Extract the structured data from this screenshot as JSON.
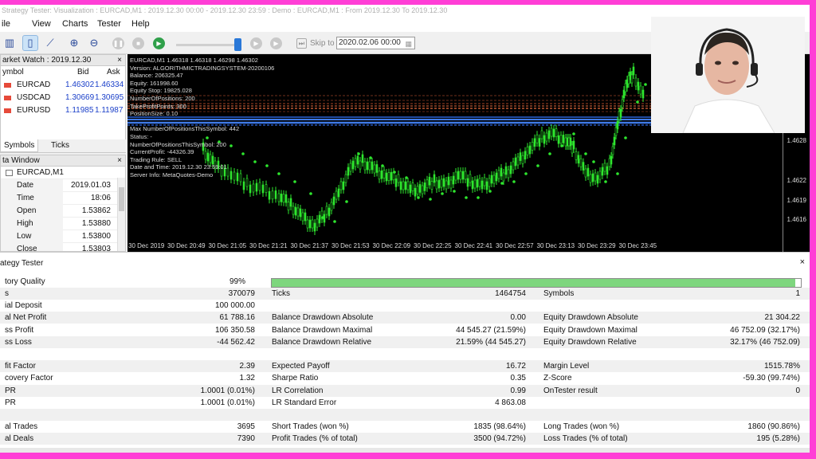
{
  "window": {
    "title": "Strategy Tester: Visualization : EURCAD,M1 : 2019.12.30 00:00 - 2019.12.30 23:59 : Demo : EURCAD,M1 : From 2019.12.30 To 2019.12.30"
  },
  "menu": [
    "ile",
    "View",
    "Charts",
    "Tester",
    "Help"
  ],
  "toolbar": {
    "skip_label": "Skip to",
    "skip_date": "2020.02.06 00:00"
  },
  "market_watch": {
    "title": "arket Watch : 2019.12.30",
    "columns": [
      "ymbol",
      "Bid",
      "Ask"
    ],
    "rows": [
      {
        "symbol": "EURCAD",
        "bid": "1.46302",
        "ask": "1.46334"
      },
      {
        "symbol": "USDCAD",
        "bid": "1.30669",
        "ask": "1.30695"
      },
      {
        "symbol": "EURUSD",
        "bid": "1.11985",
        "ask": "1.11987"
      }
    ],
    "tabs": [
      "Symbols",
      "Ticks"
    ]
  },
  "data_window": {
    "title": "ta Window",
    "symbol": "EURCAD,M1",
    "rows": [
      {
        "k": "Date",
        "v": "2019.01.03"
      },
      {
        "k": "Time",
        "v": "18:06"
      },
      {
        "k": "Open",
        "v": "1.53862"
      },
      {
        "k": "High",
        "v": "1.53880"
      },
      {
        "k": "Low",
        "v": "1.53800"
      },
      {
        "k": "Close",
        "v": "1.53803"
      }
    ]
  },
  "chart": {
    "header": "EURCAD,M1  1.46318 1.46318 1.46298 1.46302",
    "info_lines": [
      "Version: ALGORITHMICTRADINGSYSTEM-20200106",
      "Balance: 206325.47",
      "Equity: 161998.60",
      "Equity Stop: 19825.028",
      "NumberOfPositions: 200",
      "TakeProfitPoints: 300",
      "PositionSize: 0.10",
      "",
      "Max NumberOfPositionsThisSymbol: 442",
      "Status: -",
      "NumberOfPositionsThisSymbol: 200",
      "CurrentProfit: -44326.39",
      "Trading Rule: SELL",
      "Date and Time: 2019.12.30 23:59:01",
      "Server Info: MetaQuotes-Demo"
    ],
    "price_labels": [
      "1.4628",
      "1.4622",
      "1.4619",
      "1.4616"
    ],
    "time_labels": [
      "30 Dec 2019",
      "30 Dec 20:49",
      "30 Dec 21:05",
      "30 Dec 21:21",
      "30 Dec 21:37",
      "30 Dec 21:53",
      "30 Dec 22:09",
      "30 Dec 22:25",
      "30 Dec 22:41",
      "30 Dec 22:57",
      "30 Dec 23:13",
      "30 Dec 23:29",
      "30 Dec 23:45"
    ]
  },
  "strategy_tester": {
    "title": "ategy Tester",
    "quality_label": "tory Quality",
    "quality_value": "99%",
    "quality_fill": 0.99,
    "rows": [
      {
        "l1": "s",
        "v1": "370079",
        "l2": "Ticks",
        "v2": "1464754",
        "l3": "Symbols",
        "v3": "1"
      },
      {
        "l1": "ial Deposit",
        "v1": "100 000.00",
        "l2": "",
        "v2": "",
        "l3": "",
        "v3": ""
      },
      {
        "l1": "al Net Profit",
        "v1": "61 788.16",
        "l2": "Balance Drawdown Absolute",
        "v2": "0.00",
        "l3": "Equity Drawdown Absolute",
        "v3": "21 304.22"
      },
      {
        "l1": "ss Profit",
        "v1": "106 350.58",
        "l2": "Balance Drawdown Maximal",
        "v2": "44 545.27 (21.59%)",
        "l3": "Equity Drawdown Maximal",
        "v3": "46 752.09 (32.17%)"
      },
      {
        "l1": "ss Loss",
        "v1": "-44 562.42",
        "l2": "Balance Drawdown Relative",
        "v2": "21.59% (44 545.27)",
        "l3": "Equity Drawdown Relative",
        "v3": "32.17% (46 752.09)"
      },
      {
        "l1": "",
        "v1": "",
        "l2": "",
        "v2": "",
        "l3": "",
        "v3": ""
      },
      {
        "l1": "fit Factor",
        "v1": "2.39",
        "l2": "Expected Payoff",
        "v2": "16.72",
        "l3": "Margin Level",
        "v3": "1515.78%"
      },
      {
        "l1": "covery Factor",
        "v1": "1.32",
        "l2": "Sharpe Ratio",
        "v2": "0.35",
        "l3": "Z-Score",
        "v3": "-59.30 (99.74%)"
      },
      {
        "l1": "PR",
        "v1": "1.0001 (0.01%)",
        "l2": "LR Correlation",
        "v2": "0.99",
        "l3": "OnTester result",
        "v3": "0"
      },
      {
        "l1": "PR",
        "v1": "1.0001 (0.01%)",
        "l2": "LR Standard Error",
        "v2": "4 863.08",
        "l3": "",
        "v3": ""
      },
      {
        "l1": "",
        "v1": "",
        "l2": "",
        "v2": "",
        "l3": "",
        "v3": ""
      },
      {
        "l1": "al Trades",
        "v1": "3695",
        "l2": "Short Trades (won %)",
        "v2": "1835 (98.64%)",
        "l3": "Long Trades (won %)",
        "v3": "1860 (90.86%)"
      },
      {
        "l1": "al Deals",
        "v1": "7390",
        "l2": "Profit Trades (% of total)",
        "v2": "3500 (94.72%)",
        "l3": "Loss Trades (% of total)",
        "v3": "195 (5.28%)"
      }
    ]
  }
}
